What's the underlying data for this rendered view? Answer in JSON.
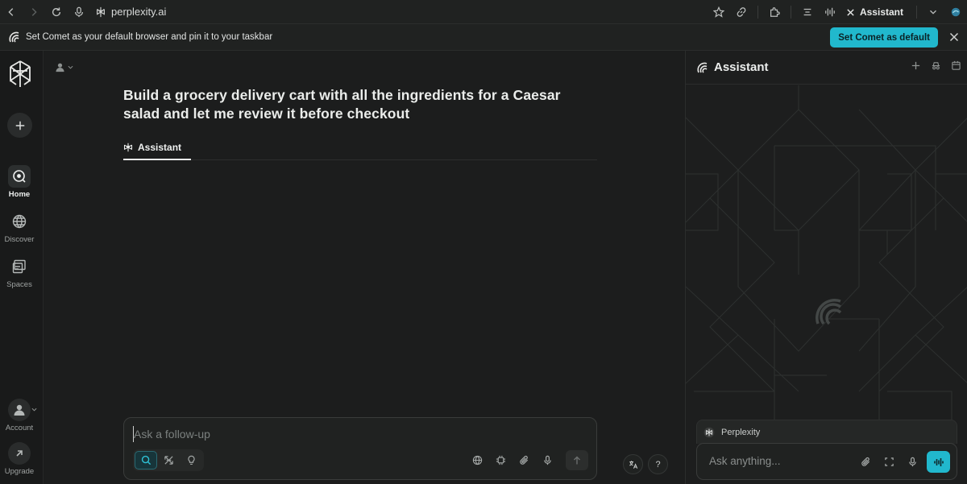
{
  "browser": {
    "url": "perplexity.ai",
    "assistant_label": "Assistant"
  },
  "infobar": {
    "message": "Set Comet as your default browser and pin it to your taskbar",
    "cta_label": "Set Comet as default"
  },
  "sidebar": {
    "items": [
      {
        "label": "Home",
        "icon": "home-search-icon",
        "active": true
      },
      {
        "label": "Discover",
        "icon": "globe-icon",
        "active": false
      },
      {
        "label": "Spaces",
        "icon": "spaces-icon",
        "active": false
      }
    ],
    "account_label": "Account",
    "upgrade_label": "Upgrade"
  },
  "main": {
    "query": "Build a grocery delivery cart with all the ingredients for a Caesar salad and let me review it before checkout",
    "tab_label": "Assistant",
    "composer_placeholder": "Ask a follow-up",
    "help_glyph": "?"
  },
  "panel": {
    "title": "Assistant",
    "context_tab": "Perplexity",
    "ask_placeholder": "Ask anything..."
  },
  "colors": {
    "accent": "#21b8cd",
    "background": "#1c1d1d",
    "sidebar": "#191a1a"
  }
}
